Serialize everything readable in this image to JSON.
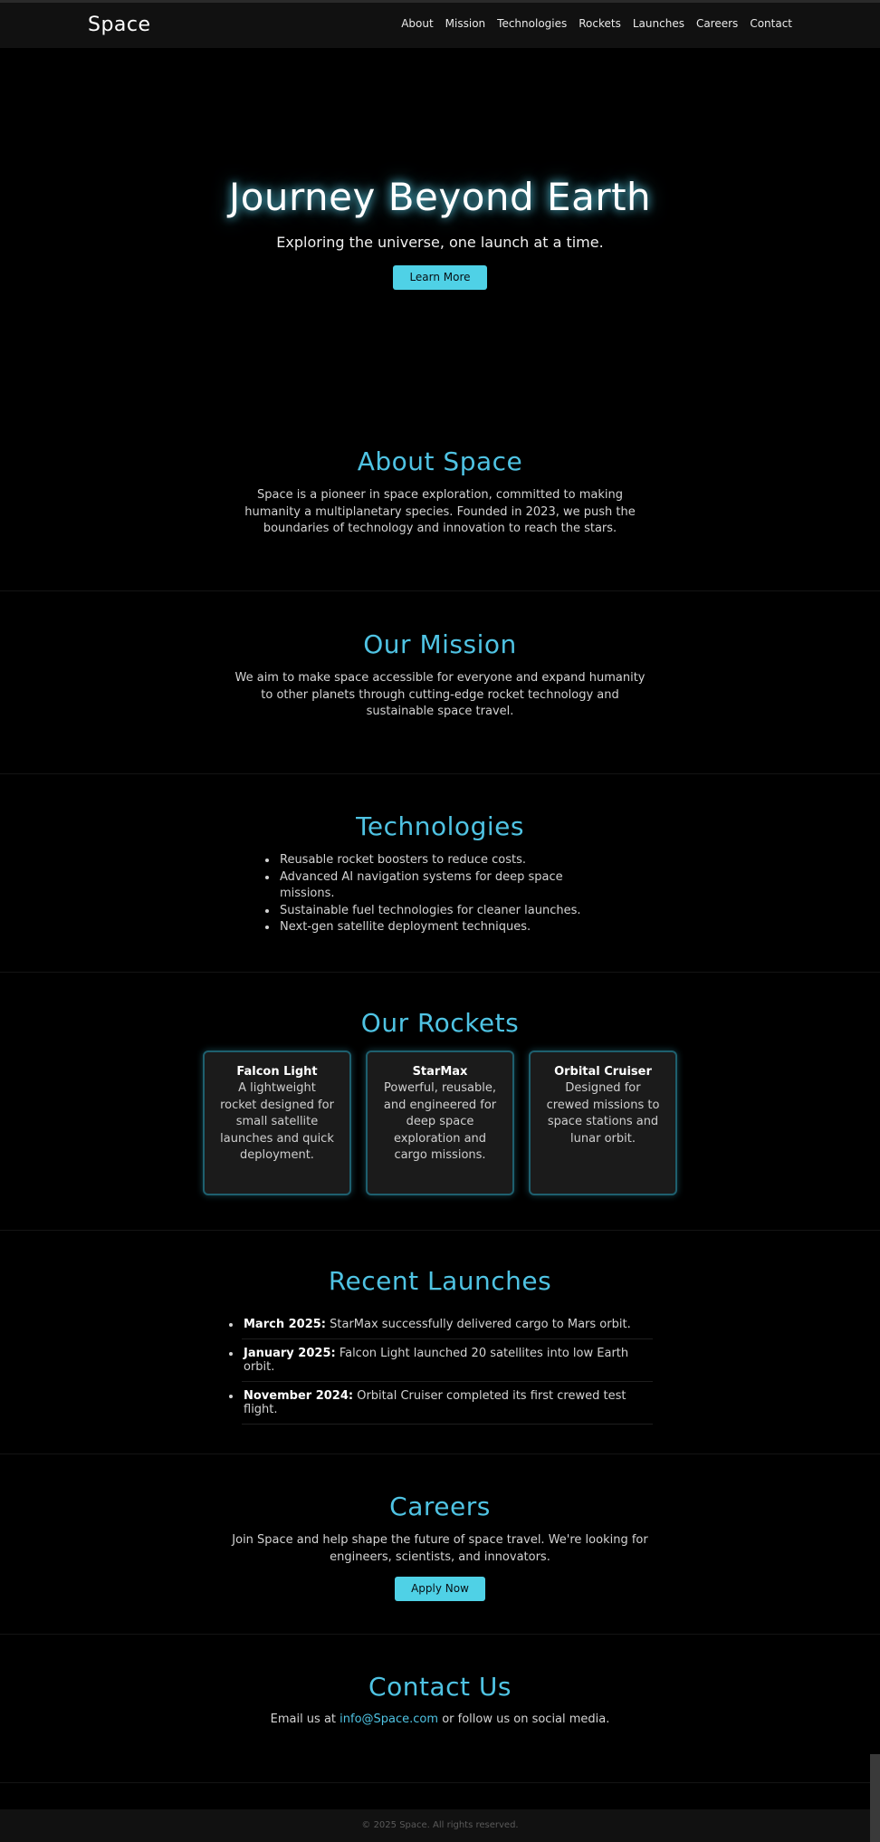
{
  "header": {
    "logo": "Space",
    "nav": [
      "About",
      "Mission",
      "Technologies",
      "Rockets",
      "Launches",
      "Careers",
      "Contact"
    ]
  },
  "hero": {
    "title": "Journey Beyond Earth",
    "subtitle": "Exploring the universe, one launch at a time.",
    "button": "Learn More"
  },
  "about": {
    "title": "About Space",
    "text": "Space is a pioneer in space exploration, committed to making humanity a multiplanetary species. Founded in 2023, we push the boundaries of technology and innovation to reach the stars."
  },
  "mission": {
    "title": "Our Mission",
    "text": "We aim to make space accessible for everyone and expand humanity to other planets through cutting-edge rocket technology and sustainable space travel."
  },
  "technologies": {
    "title": "Technologies",
    "items": [
      "Reusable rocket boosters to reduce costs.",
      "Advanced AI navigation systems for deep space missions.",
      "Sustainable fuel technologies for cleaner launches.",
      "Next-gen satellite deployment techniques."
    ]
  },
  "rockets": {
    "title": "Our Rockets",
    "cards": [
      {
        "name": "Falcon Light",
        "desc": "A lightweight rocket designed for small satellite launches and quick deployment."
      },
      {
        "name": "StarMax",
        "desc": "Powerful, reusable, and engineered for deep space exploration and cargo missions."
      },
      {
        "name": "Orbital Cruiser",
        "desc": "Designed for crewed missions to space stations and lunar orbit."
      }
    ]
  },
  "launches": {
    "title": "Recent Launches",
    "items": [
      {
        "date": "March 2025:",
        "text": " StarMax successfully delivered cargo to Mars orbit."
      },
      {
        "date": "January 2025:",
        "text": " Falcon Light launched 20 satellites into low Earth orbit."
      },
      {
        "date": "November 2024:",
        "text": " Orbital Cruiser completed its first crewed test flight."
      }
    ]
  },
  "careers": {
    "title": "Careers",
    "text": "Join Space and help shape the future of space travel. We're looking for engineers, scientists, and innovators.",
    "button": "Apply Now"
  },
  "contact": {
    "title": "Contact Us",
    "prefix": "Email us at ",
    "email": "info@Space.com",
    "suffix": " or follow us on social media."
  },
  "footer": {
    "text": "© 2025 Space. All rights reserved."
  },
  "colors": {
    "accent": "#4fc3e3",
    "button": "#4fd1e6",
    "background": "#000000"
  }
}
